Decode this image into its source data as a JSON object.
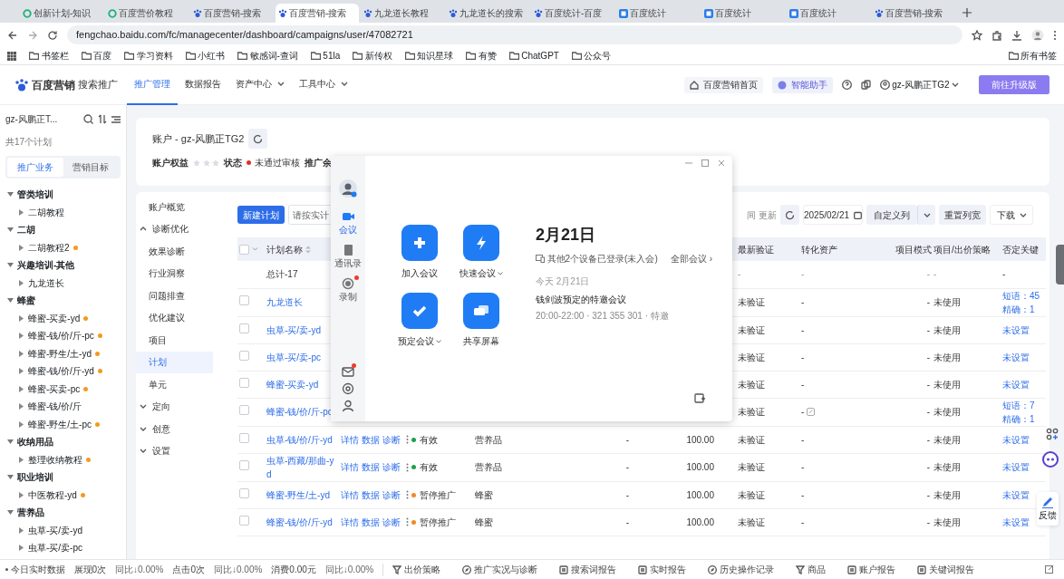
{
  "browser": {
    "tabs": [
      {
        "title": "创新计划-知识",
        "kind": "ring",
        "selected": false
      },
      {
        "title": "百度营价教程",
        "kind": "ring",
        "selected": false
      },
      {
        "title": "百度营销-搜索",
        "kind": "paw",
        "selected": false
      },
      {
        "title": "百度营销-搜索",
        "kind": "paw",
        "selected": true
      },
      {
        "title": "九龙道长教程",
        "kind": "paw",
        "selected": false
      },
      {
        "title": "九龙道长的搜索",
        "kind": "paw",
        "selected": false
      },
      {
        "title": "百度统计-百度",
        "kind": "paw",
        "selected": false
      },
      {
        "title": "百度统计",
        "kind": "square",
        "selected": false
      },
      {
        "title": "百度统计",
        "kind": "square",
        "selected": false
      },
      {
        "title": "百度统计",
        "kind": "square",
        "selected": false
      },
      {
        "title": "百度营销-搜索",
        "kind": "paw",
        "selected": false
      }
    ],
    "address": "fengchao.baidu.com/fc/managecenter/dashboard/campaigns/user/47082721",
    "bookmarks": [
      "书签栏",
      "百度",
      "学习资料",
      "小红书",
      "敏感词-查词",
      "51la",
      "新传权",
      "知识星球",
      "有赞",
      "ChatGPT",
      "公众号"
    ],
    "all_bookmarks": "所有书签"
  },
  "header": {
    "brand": "百度营销",
    "product": "搜索推广",
    "nav": [
      {
        "label": "推广管理",
        "selected": true,
        "menu": false
      },
      {
        "label": "数据报告",
        "selected": false,
        "menu": false
      },
      {
        "label": "资产中心",
        "selected": false,
        "menu": true
      },
      {
        "label": "工具中心",
        "selected": false,
        "menu": true
      }
    ],
    "home": "百度营销首页",
    "assistant": "智能助手",
    "user": "gz-风鹏正TG2",
    "upgrade": "前往升级版"
  },
  "sidebar": {
    "account": "gz-风鹏正T...",
    "count": "共17个计划",
    "tabs": [
      {
        "label": "推广业务",
        "selected": true
      },
      {
        "label": "营销目标",
        "selected": false
      }
    ],
    "tree": [
      {
        "label": "管类培训",
        "expanded": true,
        "children": [
          {
            "label": "二胡教程",
            "expanded": false,
            "marked": false
          }
        ]
      },
      {
        "label": "二胡",
        "expanded": true,
        "children": [
          {
            "label": "二胡教程2",
            "expanded": false,
            "marked": true
          }
        ]
      },
      {
        "label": "兴趣培训-其他",
        "expanded": true,
        "children": [
          {
            "label": "九龙道长",
            "expanded": false,
            "marked": false
          }
        ]
      },
      {
        "label": "蜂蜜",
        "expanded": true,
        "children": [
          {
            "label": "蜂蜜-买卖-yd",
            "expanded": false,
            "marked": true
          },
          {
            "label": "蜂蜜-钱/价/斤-pc",
            "expanded": false,
            "marked": true
          },
          {
            "label": "蜂蜜-野生/土-yd",
            "expanded": false,
            "marked": true
          },
          {
            "label": "蜂蜜-钱/价/斤-yd",
            "expanded": false,
            "marked": true
          },
          {
            "label": "蜂蜜-买卖-pc",
            "expanded": false,
            "marked": true
          },
          {
            "label": "蜂蜜-钱/价/斤",
            "expanded": false,
            "marked": false
          },
          {
            "label": "蜂蜜-野生/土-pc",
            "expanded": false,
            "marked": true
          }
        ]
      },
      {
        "label": "收纳用品",
        "expanded": true,
        "children": [
          {
            "label": "整理收纳教程",
            "expanded": false,
            "marked": true
          }
        ]
      },
      {
        "label": "职业培训",
        "expanded": true,
        "children": [
          {
            "label": "中医教程-yd",
            "expanded": false,
            "marked": true
          }
        ]
      },
      {
        "label": "营养品",
        "expanded": true,
        "children": [
          {
            "label": "虫草-买/卖-yd",
            "expanded": false,
            "marked": false
          },
          {
            "label": "虫草-买/卖-pc",
            "expanded": false,
            "marked": false
          }
        ]
      }
    ]
  },
  "account": {
    "title": "账户 - gz-风鹏正TG2",
    "rights_label": "账户权益",
    "stars": 0,
    "status_label": "状态",
    "status": {
      "text": "未通过审核",
      "color": "#e0302a"
    },
    "balance_label": "推广余"
  },
  "nav": [
    {
      "label": "账户概览",
      "kind": "link",
      "selected": false
    },
    {
      "label": "诊断优化",
      "kind": "group",
      "expanded": true,
      "children": [
        {
          "label": "效果诊断",
          "kind": "link",
          "selected": false
        },
        {
          "label": "行业洞察",
          "kind": "link",
          "selected": false
        },
        {
          "label": "问题排查",
          "kind": "link",
          "selected": false
        },
        {
          "label": "优化建议",
          "kind": "link",
          "selected": false
        }
      ]
    },
    {
      "label": "项目",
      "kind": "link",
      "selected": false
    },
    {
      "label": "计划",
      "kind": "link",
      "selected": true
    },
    {
      "label": "单元",
      "kind": "link",
      "selected": false
    },
    {
      "label": "定向",
      "kind": "group",
      "expanded": false
    },
    {
      "label": "创意",
      "kind": "group",
      "expanded": false
    },
    {
      "label": "设置",
      "kind": "group",
      "expanded": false
    }
  ],
  "toolbar": {
    "new_plan": "新建计划",
    "search_placeholder": "请按实计",
    "update": "间 更新",
    "date": "2025/02/21",
    "custom_columns": "自定义列",
    "reset_width": "重置列宽",
    "download": "下载"
  },
  "table": {
    "select_all_checked": false,
    "header": {
      "name": "计划名称",
      "verify": "最新验证",
      "asset": "转化资产",
      "mode": "项目模式",
      "strategy": "项目/出价策略",
      "negative": "否定关键"
    },
    "total": {
      "name": "总计-17",
      "verify": "-",
      "asset": "-",
      "mode": "-",
      "strategy": "-",
      "negative": [
        "-"
      ]
    },
    "rows": [
      {
        "name": "九龙道长",
        "checked": false,
        "verify": "未验证",
        "asset": "-",
        "mode": "-",
        "strategy": "未使用",
        "negative": [
          "短语：45",
          "精确：1"
        ]
      },
      {
        "name": "虫草-买/卖-yd",
        "checked": false,
        "verify": "未验证",
        "asset": "-",
        "mode": "-",
        "strategy": "未使用",
        "negative": [
          "未设置"
        ]
      },
      {
        "name": "虫草-买/卖-pc",
        "checked": false,
        "verify": "未验证",
        "asset": "-",
        "mode": "-",
        "strategy": "未使用",
        "negative": [
          "未设置"
        ]
      },
      {
        "name": "蜂蜜-买卖-yd",
        "checked": false,
        "verify": "未验证",
        "asset": "-",
        "mode": "-",
        "strategy": "未使用",
        "negative": [
          "未设置"
        ]
      },
      {
        "name": "蜂蜜-钱/价/斤-pc",
        "checked": false,
        "verify": "未验证",
        "asset": "-",
        "asset_edit": true,
        "mode": "-",
        "strategy": "未使用",
        "negative": [
          "短语：7",
          "精确：1"
        ]
      },
      {
        "name": "虫草-钱/价/斤-yd",
        "checked": false,
        "actions": [
          "详情",
          "数据",
          "诊断"
        ],
        "status": {
          "text": "有效",
          "color": "#1aa34a"
        },
        "category": "营养品",
        "col_6": "-",
        "budget": "100.00",
        "verify": "未验证",
        "asset": "-",
        "mode": "-",
        "strategy": "未使用",
        "negative": [
          "未设置"
        ]
      },
      {
        "name": "虫草-西藏/那曲-yd",
        "checked": false,
        "actions": [
          "详情",
          "数据",
          "诊断"
        ],
        "status": {
          "text": "有效",
          "color": "#1aa34a"
        },
        "category": "营养品",
        "col_6": "-",
        "budget": "100.00",
        "verify": "未验证",
        "asset": "-",
        "mode": "-",
        "strategy": "未使用",
        "negative": [
          "未设置"
        ]
      },
      {
        "name": "蜂蜜-野生/土-yd",
        "checked": false,
        "actions": [
          "详情",
          "数据",
          "诊断"
        ],
        "status": {
          "text": "暂停推广",
          "color": "#f08a24"
        },
        "category": "蜂蜜",
        "col_6": "-",
        "budget": "100.00",
        "verify": "未验证",
        "asset": "-",
        "mode": "-",
        "strategy": "未使用",
        "negative": [
          "未设置"
        ]
      },
      {
        "name": "蜂蜜-钱/价/斤-yd",
        "checked": false,
        "actions": [
          "详情",
          "数据",
          "诊断"
        ],
        "status": {
          "text": "暂停推广",
          "color": "#f08a24"
        },
        "category": "蜂蜜",
        "col_6": "-",
        "budget": "100.00",
        "verify": "未验证",
        "asset": "-",
        "mode": "-",
        "strategy": "未使用",
        "negative": [
          "未设置"
        ]
      }
    ]
  },
  "meeting": {
    "rail": [
      {
        "label": "会议",
        "kind": "video",
        "selected": true,
        "badge": false
      },
      {
        "label": "通讯录",
        "kind": "book",
        "selected": false,
        "badge": false
      },
      {
        "label": "录制",
        "kind": "record",
        "selected": false,
        "badge": true
      }
    ],
    "rail_bottom": [
      {
        "kind": "mail",
        "badge": true
      },
      {
        "kind": "settings",
        "badge": false
      },
      {
        "kind": "user",
        "badge": false
      }
    ],
    "actions": [
      {
        "label": "加入会议",
        "kind": "plus",
        "menu": false
      },
      {
        "label": "快速会议",
        "kind": "bolt",
        "menu": true
      },
      {
        "label": "预定会议",
        "kind": "check",
        "menu": true
      },
      {
        "label": "共享屏幕",
        "kind": "screen",
        "menu": false
      }
    ],
    "date": "2月21日",
    "devices": "其他2个设备已登录(未入会)",
    "all": "全部会议 ›",
    "day": "今天 2月21日",
    "event": "钱剑波预定的特邀会议",
    "event_detail": "20:00-22:00 · 321 355 301 · 特邀"
  },
  "float": {
    "feedback": "反馈"
  },
  "status_bar": {
    "realtime": "今日实时数据",
    "stats": [
      {
        "label": "展现0次",
        "change": "同比↓0.00%"
      },
      {
        "label": "点击0次",
        "change": "同比↓0.00%"
      },
      {
        "label": "消费0.00元",
        "change": "同比↓0.00%"
      }
    ],
    "links": [
      {
        "label": "出价策略",
        "kind": "filter"
      },
      {
        "label": "推广实况与诊断",
        "kind": "compass"
      },
      {
        "label": "搜索词报告",
        "kind": "doc"
      },
      {
        "label": "实时报告",
        "kind": "doc"
      },
      {
        "label": "历史操作记录",
        "kind": "compass"
      },
      {
        "label": "商品",
        "kind": "filter"
      },
      {
        "label": "账户报告",
        "kind": "doc"
      },
      {
        "label": "关键词报告",
        "kind": "doc"
      }
    ]
  }
}
